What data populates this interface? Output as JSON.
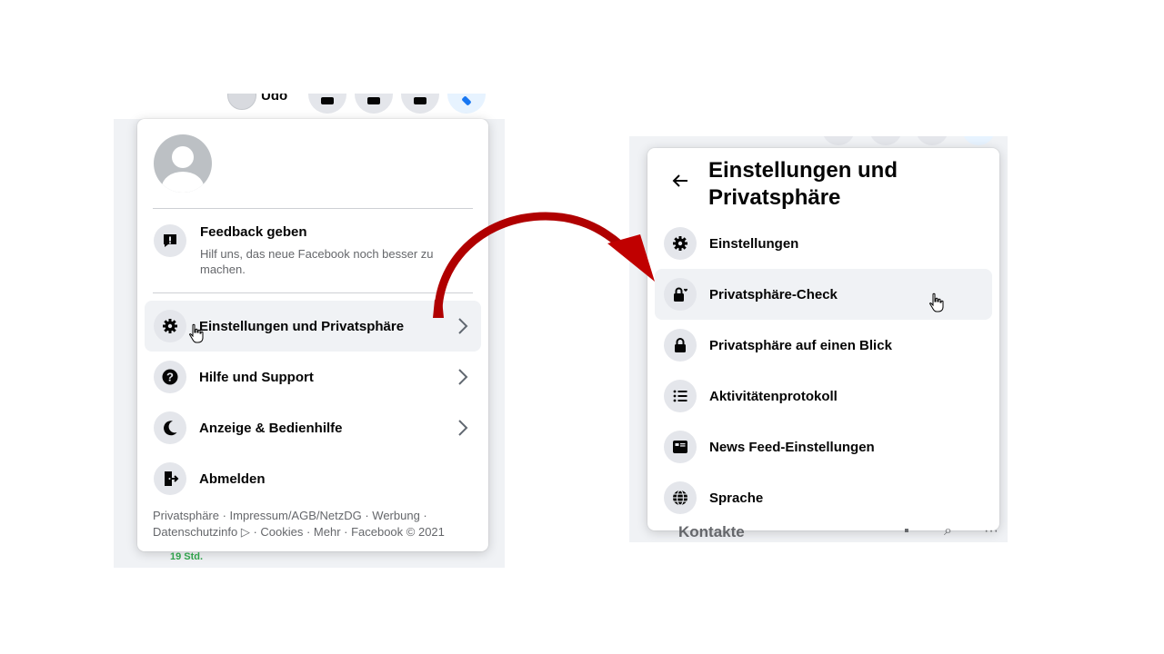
{
  "left_panel": {
    "top_bar": {
      "user_name": "Udo"
    },
    "feedback": {
      "title": "Feedback geben",
      "subtitle": "Hilf uns, das neue Facebook noch besser zu machen."
    },
    "items": [
      {
        "label": "Einstellungen und Privatsphäre",
        "icon": "gear-icon",
        "has_chevron": true,
        "highlighted": true
      },
      {
        "label": "Hilfe und Support",
        "icon": "question-icon",
        "has_chevron": true
      },
      {
        "label": "Anzeige & Bedienhilfe",
        "icon": "moon-icon",
        "has_chevron": true
      },
      {
        "label": "Abmelden",
        "icon": "logout-icon",
        "has_chevron": false
      }
    ],
    "footer_line1": "Privatsphäre · Impressum/AGB/NetzDG · Werbung ·",
    "footer_line2": "Datenschutzinfo ▷ · Cookies · Mehr · Facebook © 2021",
    "bottom_time": "19 Std."
  },
  "right_panel": {
    "title": "Einstellungen und Privatsphäre",
    "items": [
      {
        "label": "Einstellungen",
        "icon": "gear-icon"
      },
      {
        "label": "Privatsphäre-Check",
        "icon": "lock-heart-icon",
        "highlighted": true
      },
      {
        "label": "Privatsphäre auf einen Blick",
        "icon": "lock-icon"
      },
      {
        "label": "Aktivitätenprotokoll",
        "icon": "list-icon"
      },
      {
        "label": "News Feed-Einstellungen",
        "icon": "feed-icon"
      },
      {
        "label": "Sprache",
        "icon": "globe-icon"
      }
    ],
    "bottom_label": "Kontakte"
  },
  "colors": {
    "page_bg": "#f0f2f5",
    "card_bg": "#ffffff",
    "icon_bg": "#e4e6eb",
    "hover_bg": "#f0f2f5",
    "secondary_text": "#65676b",
    "arrow_red": "#c00000",
    "time_green": "#31a24c"
  }
}
